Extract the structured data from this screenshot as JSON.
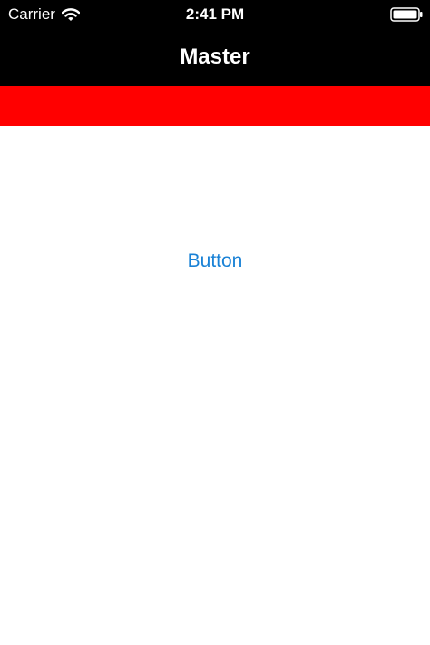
{
  "status_bar": {
    "carrier": "Carrier",
    "time": "2:41 PM",
    "wifi_icon": "wifi-icon",
    "battery_icon": "battery-icon"
  },
  "nav_bar": {
    "title": "Master"
  },
  "content": {
    "button_label": "Button"
  },
  "colors": {
    "status_bar_bg": "#000000",
    "nav_bar_bg": "#000000",
    "banner": "#ff0000",
    "button_text": "#1a82d6",
    "background": "#ffffff"
  }
}
